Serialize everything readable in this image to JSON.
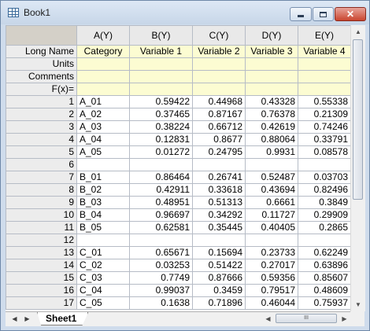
{
  "window": {
    "title": "Book1"
  },
  "sheet_tab": "Sheet1",
  "columns": [
    {
      "label": "A(Y)"
    },
    {
      "label": "B(Y)"
    },
    {
      "label": "C(Y)"
    },
    {
      "label": "D(Y)"
    },
    {
      "label": "E(Y)"
    }
  ],
  "meta_rows": [
    {
      "label": "Long Name",
      "values": [
        "Category",
        "Variable 1",
        "Variable 2",
        "Variable 3",
        "Variable 4"
      ]
    },
    {
      "label": "Units",
      "values": [
        "",
        "",
        "",
        "",
        ""
      ]
    },
    {
      "label": "Comments",
      "values": [
        "",
        "",
        "",
        "",
        ""
      ]
    },
    {
      "label": "F(x)=",
      "values": [
        "",
        "",
        "",
        "",
        ""
      ]
    }
  ],
  "rows": [
    {
      "n": "1",
      "cells": [
        "A_01",
        "0.59422",
        "0.44968",
        "0.43328",
        "0.55338"
      ]
    },
    {
      "n": "2",
      "cells": [
        "A_02",
        "0.37465",
        "0.87167",
        "0.76378",
        "0.21309"
      ]
    },
    {
      "n": "3",
      "cells": [
        "A_03",
        "0.38224",
        "0.66712",
        "0.42619",
        "0.74246"
      ]
    },
    {
      "n": "4",
      "cells": [
        "A_04",
        "0.12831",
        "0.8677",
        "0.88064",
        "0.33791"
      ]
    },
    {
      "n": "5",
      "cells": [
        "A_05",
        "0.01272",
        "0.24795",
        "0.9931",
        "0.08578"
      ]
    },
    {
      "n": "6",
      "cells": [
        "",
        "",
        "",
        "",
        ""
      ]
    },
    {
      "n": "7",
      "cells": [
        "B_01",
        "0.86464",
        "0.26741",
        "0.52487",
        "0.03703"
      ]
    },
    {
      "n": "8",
      "cells": [
        "B_02",
        "0.42911",
        "0.33618",
        "0.43694",
        "0.82496"
      ]
    },
    {
      "n": "9",
      "cells": [
        "B_03",
        "0.48951",
        "0.51313",
        "0.6661",
        "0.3849"
      ]
    },
    {
      "n": "10",
      "cells": [
        "B_04",
        "0.96697",
        "0.34292",
        "0.11727",
        "0.29909"
      ]
    },
    {
      "n": "11",
      "cells": [
        "B_05",
        "0.62581",
        "0.35445",
        "0.40405",
        "0.2865"
      ]
    },
    {
      "n": "12",
      "cells": [
        "",
        "",
        "",
        "",
        ""
      ]
    },
    {
      "n": "13",
      "cells": [
        "C_01",
        "0.65671",
        "0.15694",
        "0.23733",
        "0.62249"
      ]
    },
    {
      "n": "14",
      "cells": [
        "C_02",
        "0.03253",
        "0.51422",
        "0.27017",
        "0.63896"
      ]
    },
    {
      "n": "15",
      "cells": [
        "C_03",
        "0.7749",
        "0.87666",
        "0.59356",
        "0.85607"
      ]
    },
    {
      "n": "16",
      "cells": [
        "C_04",
        "0.99037",
        "0.3459",
        "0.79517",
        "0.48609"
      ]
    },
    {
      "n": "17",
      "cells": [
        "C_05",
        "0.1638",
        "0.71896",
        "0.46044",
        "0.75937"
      ]
    }
  ],
  "scrollbar": {
    "grip": "III"
  }
}
